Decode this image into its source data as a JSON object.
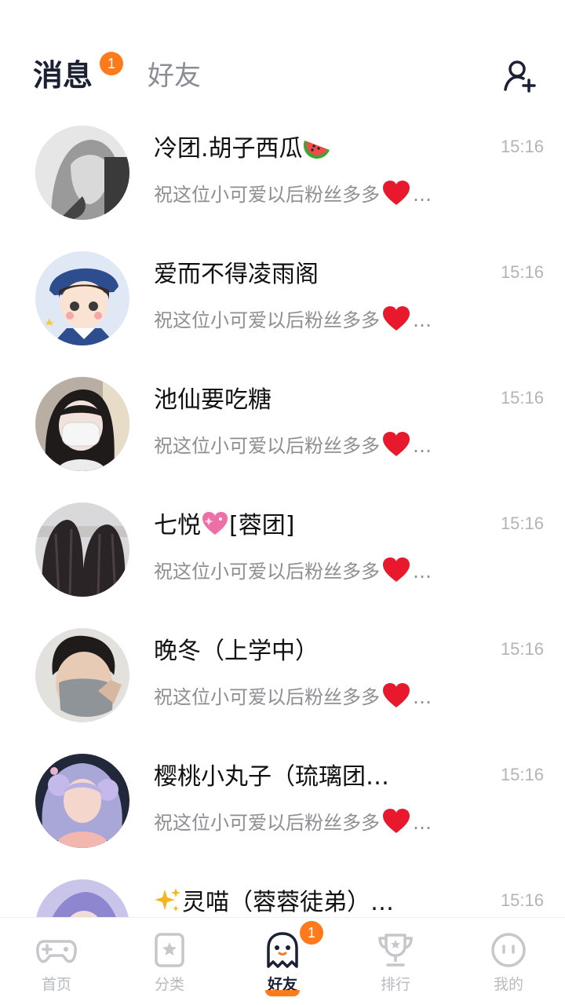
{
  "header": {
    "tab_messages": "消息",
    "messages_badge": "1",
    "tab_friends": "好友"
  },
  "conversations": [
    {
      "name": "冷团.胡子西瓜",
      "name_emoji": "watermelon",
      "preview": "祝这位小可爱以后粉丝多多",
      "preview_emoji": "red-heart",
      "ellipsis": "…",
      "time": "15:16"
    },
    {
      "name": "爱而不得凌雨阁",
      "preview": "祝这位小可爱以后粉丝多多",
      "preview_emoji": "red-heart",
      "ellipsis": "…",
      "time": "15:16"
    },
    {
      "name": "池仙要吃糖",
      "preview": "祝这位小可爱以后粉丝多多",
      "preview_emoji": "red-heart",
      "ellipsis": "…",
      "time": "15:16"
    },
    {
      "name_prefix": "七悦",
      "name_emoji": "sparkling-heart",
      "name_suffix": "[蓉团]",
      "preview": "祝这位小可爱以后粉丝多多",
      "preview_emoji": "red-heart",
      "ellipsis": "…",
      "time": "15:16"
    },
    {
      "name": "晚冬（上学中）",
      "preview": "祝这位小可爱以后粉丝多多",
      "preview_emoji": "red-heart",
      "ellipsis": "…",
      "time": "15:16"
    },
    {
      "name": "樱桃小丸子（琉璃团…",
      "preview": "祝这位小可爱以后粉丝多多",
      "preview_emoji": "red-heart",
      "ellipsis": "…",
      "time": "15:16"
    },
    {
      "name_emoji": "sparkles",
      "name": "灵喵（蓉蓉徒弟）…",
      "time": "15:16"
    }
  ],
  "tabbar": {
    "home": "首页",
    "category": "分类",
    "friends": "好友",
    "friends_badge": "1",
    "ranking": "排行",
    "mine": "我的"
  },
  "colors": {
    "accent": "#ff7a1a",
    "title": "#1b2033",
    "muted": "#8e8e93"
  }
}
